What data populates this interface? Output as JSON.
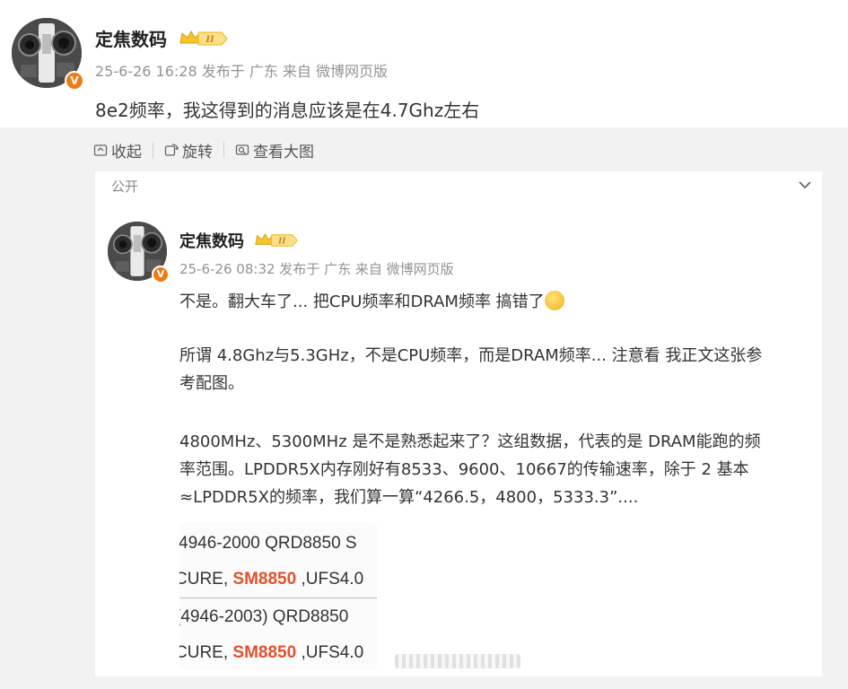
{
  "post": {
    "author": "定焦数码",
    "badge_level": "II",
    "verified_mark": "V",
    "meta": "25-6-26 16:28  发布于 广东  来自 微博网页版",
    "text": "8e2频率，我这得到的消息应该是在4.7Ghz左右"
  },
  "toolbar": {
    "collapse_label": "收起",
    "rotate_label": "旋转",
    "view_large_label": "查看大图"
  },
  "repost": {
    "visibility": "公开",
    "author": "定焦数码",
    "badge_level": "II",
    "verified_mark": "V",
    "meta": "25-6-26 08:32  发布于 广东  来自 微博网页版",
    "para1": "不是。翻大车了... 把CPU频率和DRAM频率 搞错了",
    "para2_line1": "所谓 4.8Ghz与5.3GHz，不是CPU频率，而是DRAM频率... 注意看 我正文这张参",
    "para2_line2": "考配图。",
    "para3_line1": "4800MHz、5300MHz 是不是熟悉起来了？这组数据，代表的是 DRAM能跑的频",
    "para3_line2": "率范围。LPDDR5X内存刚好有8533、9600、10667的传输速率，除于 2 基本",
    "para3_line3": "≈LPDDR5X的频率，我们算一算“4266.5，4800，5333.3”....",
    "image": {
      "line1": "4946-2000 QRD8850 S",
      "line2_pre": "CURE, ",
      "line2_hl": "SM8850",
      "line2_post": " ,UFS4.0",
      "line3": "(4946-2003) QRD8850",
      "line4_pre": "CURE, ",
      "line4_hl": "SM8850",
      "line4_post": " ,UFS4.0"
    }
  },
  "colors": {
    "badge_orange": "#f07a14",
    "highlight": "#e2522a",
    "meta_gray": "#939393",
    "expanded_bg": "#f2f2f2"
  },
  "icons": [
    "collapse-icon",
    "rotate-icon",
    "view-large-icon",
    "chevron-down-icon",
    "crown-badge-icon",
    "verified-v-icon",
    "emoji-icon"
  ]
}
